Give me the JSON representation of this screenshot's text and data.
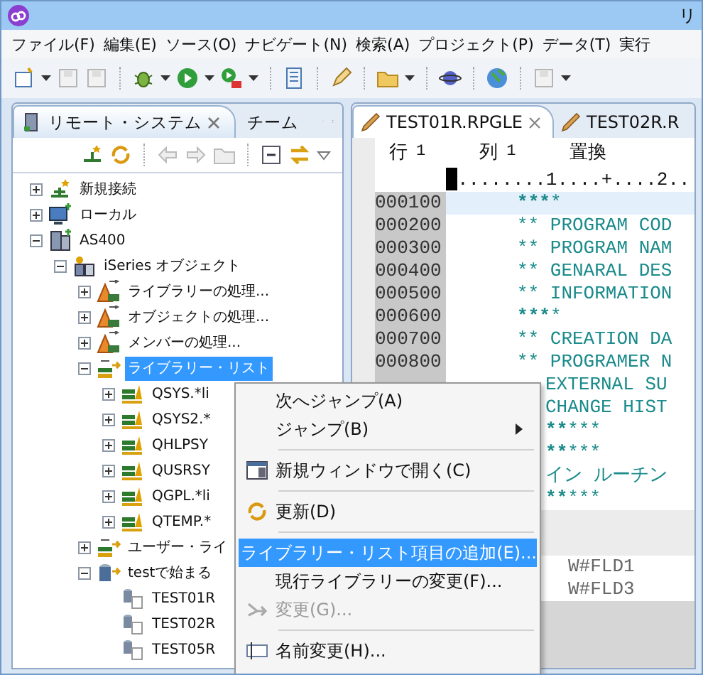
{
  "window": {
    "title": "リ"
  },
  "menu_bar": [
    "ファイル(F)",
    "編集(E)",
    "ソース(O)",
    "ナビゲート(N)",
    "検索(A)",
    "プロジェクト(P)",
    "データ(T)",
    "実行"
  ],
  "left_panel": {
    "tabs": [
      {
        "label": "リモート・システム",
        "selected": true
      },
      {
        "label": "チーム",
        "selected": false
      }
    ]
  },
  "tree": [
    {
      "label": "新規接続",
      "kind": "connection",
      "expanded": false,
      "selected": false
    },
    {
      "label": "ローカル",
      "kind": "local",
      "expanded": false,
      "selected": false
    },
    {
      "label": "AS400",
      "kind": "system",
      "expanded": true,
      "selected": false,
      "children": [
        {
          "label": "iSeries オブジェクト",
          "kind": "objects",
          "expanded": true,
          "selected": false,
          "children": [
            {
              "label": "ライブラリーの処理...",
              "kind": "filter",
              "expanded": false,
              "selected": false
            },
            {
              "label": "オブジェクトの処理...",
              "kind": "filter",
              "expanded": false,
              "selected": false
            },
            {
              "label": "メンバーの処理...",
              "kind": "filter",
              "expanded": false,
              "selected": false
            },
            {
              "label": "ライブラリー・リスト",
              "kind": "library-list",
              "expanded": true,
              "selected": true,
              "children": [
                {
                  "label": "QSYS.*li",
                  "kind": "library",
                  "expanded": false,
                  "selected": false
                },
                {
                  "label": "QSYS2.*",
                  "kind": "library",
                  "expanded": false,
                  "selected": false
                },
                {
                  "label": "QHLPSY",
                  "kind": "library",
                  "expanded": false,
                  "selected": false
                },
                {
                  "label": "QUSRSY",
                  "kind": "library",
                  "expanded": false,
                  "selected": false
                },
                {
                  "label": "QGPL.*li",
                  "kind": "library",
                  "expanded": false,
                  "selected": false
                },
                {
                  "label": "QTEMP.*",
                  "kind": "library",
                  "expanded": false,
                  "selected": false
                }
              ]
            },
            {
              "label": "ユーザー・ライ",
              "kind": "library-list",
              "expanded": false,
              "selected": false
            },
            {
              "label": "testで始まる",
              "kind": "member-filter",
              "expanded": true,
              "selected": false,
              "children": [
                {
                  "label": "TEST01R",
                  "kind": "member",
                  "selected": false
                },
                {
                  "label": "TEST02R",
                  "kind": "member",
                  "selected": false
                },
                {
                  "label": "TEST05R",
                  "kind": "member",
                  "selected": false
                }
              ]
            }
          ]
        }
      ]
    }
  ],
  "editor": {
    "tabs": [
      {
        "label": "TEST01R.RPGLE",
        "selected": true,
        "closable": true
      },
      {
        "label": "TEST02R.R",
        "selected": false,
        "closable": false
      }
    ],
    "status": {
      "row_label": "行",
      "row": "1",
      "column_label": "列",
      "column": "1",
      "mode": "置換"
    },
    "ruler": "........1....+....2..",
    "lines": [
      {
        "kind": "numbered",
        "number": "000100",
        "text": "****************",
        "current": true
      },
      {
        "kind": "numbered",
        "number": "000200",
        "text": "**   PROGRAM COD",
        "current": false
      },
      {
        "kind": "numbered",
        "number": "000300",
        "text": "**   PROGRAM NAM",
        "current": false
      },
      {
        "kind": "numbered",
        "number": "000400",
        "text": "**   GENARAL DES",
        "current": false
      },
      {
        "kind": "numbered",
        "number": "000500",
        "text": "**   INFORMATION",
        "current": false
      },
      {
        "kind": "numbered",
        "number": "000600",
        "text": "****************",
        "current": false
      },
      {
        "kind": "numbered",
        "number": "000700",
        "text": "**   CREATION DA",
        "current": false
      },
      {
        "kind": "numbered",
        "number": "000800",
        "text": "**   PROGRAMER N",
        "current": false
      },
      {
        "kind": "covered",
        "text": "EXTERNAL SU",
        "current": false
      },
      {
        "kind": "covered",
        "text": "CHANGE HIST",
        "current": false
      },
      {
        "kind": "covered",
        "text": "*************",
        "current": false
      },
      {
        "kind": "covered",
        "text": "*************",
        "current": false
      },
      {
        "kind": "covered",
        "text": "イン ルーチン",
        "current": false
      },
      {
        "kind": "covered",
        "text": "*************",
        "current": false
      },
      {
        "kind": "covered-gap",
        "text": "W#FLD1",
        "current": false
      },
      {
        "kind": "covered-gap",
        "text": "W#FLD3",
        "current": false
      }
    ]
  },
  "context_menu": [
    {
      "kind": "item",
      "label": "次へジャンプ(A)",
      "selected": false,
      "disabled": false,
      "submenu": false
    },
    {
      "kind": "item",
      "label": "ジャンプ(B)",
      "selected": false,
      "disabled": false,
      "submenu": true
    },
    {
      "kind": "separator"
    },
    {
      "kind": "window-item",
      "label": "新規ウィンドウで開く(C)",
      "selected": false,
      "disabled": false,
      "submenu": false
    },
    {
      "kind": "separator"
    },
    {
      "kind": "refresh-item",
      "label": "更新(D)",
      "selected": false,
      "disabled": false,
      "submenu": false
    },
    {
      "kind": "separator"
    },
    {
      "kind": "item",
      "label": "ライブラリー・リスト項目の追加(E)...",
      "selected": true,
      "disabled": false,
      "submenu": false
    },
    {
      "kind": "item",
      "label": "現行ライブラリーの変更(F)...",
      "selected": false,
      "disabled": false,
      "submenu": false
    },
    {
      "kind": "change-item",
      "label": "変更(G)...",
      "selected": false,
      "disabled": true,
      "submenu": false
    },
    {
      "kind": "separator"
    },
    {
      "kind": "rename-item",
      "label": "名前変更(H)...",
      "selected": false,
      "disabled": false,
      "submenu": false
    }
  ]
}
